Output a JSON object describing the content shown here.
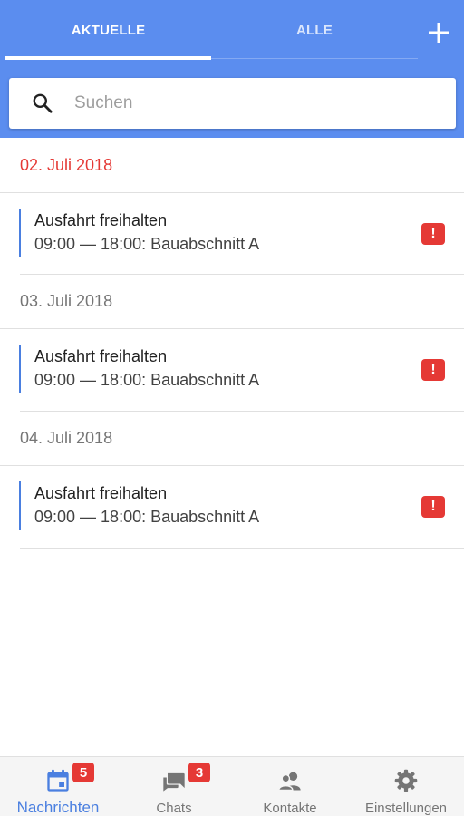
{
  "header": {
    "tabs": [
      {
        "label": "AKTUELLE",
        "active": true
      },
      {
        "label": "ALLE",
        "active": false
      }
    ],
    "add_icon": "plus-icon",
    "accent_color": "#5b8def"
  },
  "search": {
    "placeholder": "Suchen",
    "value": "",
    "icon": "search-icon"
  },
  "days": [
    {
      "date": "02. Juli 2018",
      "highlight": true,
      "events": [
        {
          "title": "Ausfahrt freihalten",
          "time": "09:00 — 18:00: Bauabschnitt A",
          "alert": "!"
        }
      ]
    },
    {
      "date": "03. Juli 2018",
      "highlight": false,
      "events": [
        {
          "title": "Ausfahrt freihalten",
          "time": "09:00 — 18:00: Bauabschnitt A",
          "alert": "!"
        }
      ]
    },
    {
      "date": "04. Juli 2018",
      "highlight": false,
      "events": [
        {
          "title": "Ausfahrt freihalten",
          "time": "09:00 — 18:00: Bauabschnitt A",
          "alert": "!"
        }
      ]
    }
  ],
  "bottom_nav": [
    {
      "label": "Nachrichten",
      "icon": "calendar-icon",
      "badge": "5",
      "active": true
    },
    {
      "label": "Chats",
      "icon": "chat-icon",
      "badge": "3",
      "active": false
    },
    {
      "label": "Kontakte",
      "icon": "contacts-icon",
      "badge": "",
      "active": false
    },
    {
      "label": "Einstellungen",
      "icon": "gear-icon",
      "badge": "",
      "active": false
    }
  ],
  "colors": {
    "today": "#e53935",
    "alert": "#e53935",
    "event_bar": "#4a7fe0",
    "nav_active": "#4a7fe0"
  }
}
